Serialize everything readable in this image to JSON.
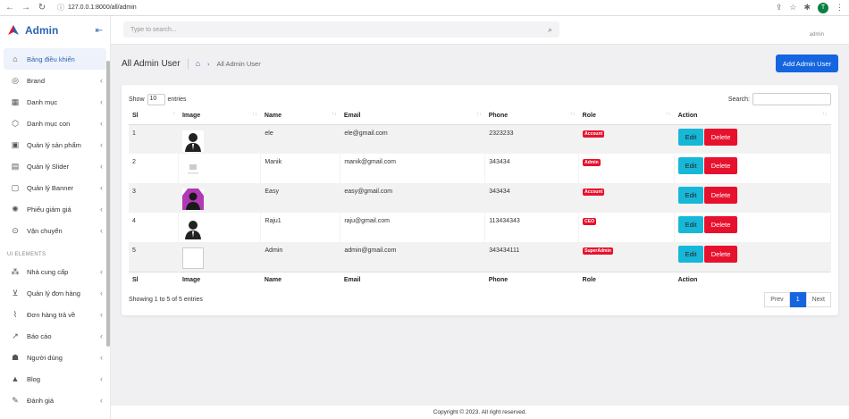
{
  "browser": {
    "url": "127.0.0.1:8000/all/admin",
    "profile_initial": "T"
  },
  "sidebar": {
    "brand": "Admin",
    "items": [
      {
        "label": "Bảng điều khiển",
        "icon": "home-icon",
        "glyph": "⌂",
        "active": true,
        "chevron": false
      },
      {
        "label": "Brand",
        "icon": "palette-icon",
        "glyph": "◎",
        "chevron": true
      },
      {
        "label": "Danh mục",
        "icon": "grid-icon",
        "glyph": "▦",
        "chevron": true
      },
      {
        "label": "Danh mục con",
        "icon": "box-icon",
        "glyph": "⬡",
        "chevron": true
      },
      {
        "label": "Quản lý sản phẩm",
        "icon": "products-icon",
        "glyph": "▣",
        "chevron": true
      },
      {
        "label": "Quản lý Slider",
        "icon": "slider-icon",
        "glyph": "▤",
        "chevron": true
      },
      {
        "label": "Quản lý Banner",
        "icon": "banner-icon",
        "glyph": "▢",
        "chevron": true
      },
      {
        "label": "Phiếu giảm giá",
        "icon": "coupon-icon",
        "glyph": "✺",
        "chevron": true
      },
      {
        "label": "Vận chuyển",
        "icon": "shipping-icon",
        "glyph": "⊙",
        "chevron": true
      }
    ],
    "section_label": "UI ELEMENTS",
    "items2": [
      {
        "label": "Nhà cung cấp",
        "icon": "supplier-icon",
        "glyph": "⁂",
        "chevron": true
      },
      {
        "label": "Quản lý đơn hàng",
        "icon": "cart-icon",
        "glyph": "⊻",
        "chevron": true
      },
      {
        "label": "Đơn hàng trả về",
        "icon": "attachment-icon",
        "glyph": "⌇",
        "chevron": true
      },
      {
        "label": "Báo cáo",
        "icon": "chart-icon",
        "glyph": "↗",
        "chevron": true
      },
      {
        "label": "Người dùng",
        "icon": "users-icon",
        "glyph": "☗",
        "chevron": true
      },
      {
        "label": "Blog",
        "icon": "blog-icon",
        "glyph": "▲",
        "chevron": true
      },
      {
        "label": "Đánh giá",
        "icon": "review-icon",
        "glyph": "✎",
        "chevron": true
      }
    ]
  },
  "topbar": {
    "search_placeholder": "Type to search...",
    "user_role": "admin"
  },
  "page": {
    "title": "All Admin User",
    "breadcrumb": "All Admin User",
    "add_button": "Add Admin User"
  },
  "table": {
    "show_label": "Show",
    "length_value": "10",
    "entries_label": "entries",
    "search_label": "Search:",
    "columns": [
      "Sl",
      "Image",
      "Name",
      "Email",
      "Phone",
      "Role",
      "Action"
    ],
    "rows": [
      {
        "sl": "1",
        "image": "person",
        "name": "ele",
        "email": "ele@gmail.com",
        "phone": "2323233",
        "role": "Account"
      },
      {
        "sl": "2",
        "image": "noimage",
        "name": "Manik",
        "email": "manik@gmail.com",
        "phone": "343434",
        "role": "Admin"
      },
      {
        "sl": "3",
        "image": "purple",
        "name": "Easy",
        "email": "easy@gmail.com",
        "phone": "343434",
        "role": "Account"
      },
      {
        "sl": "4",
        "image": "person",
        "name": "Raju1",
        "email": "raju@gmail.com",
        "phone": "113434343",
        "role": "CEO"
      },
      {
        "sl": "5",
        "image": "broken",
        "name": "Admin",
        "email": "admin@gmail.com",
        "phone": "343434111",
        "role": "SuperAdmin"
      }
    ],
    "edit_label": "Edit",
    "delete_label": "Delete",
    "info": "Showing 1 to 5 of 5 entries",
    "prev": "Prev",
    "page": "1",
    "next": "Next"
  },
  "footer": {
    "text": "Copyright © 2023. All right reserved."
  },
  "colors": {
    "primary": "#1565e0",
    "info": "#17b7d8",
    "danger": "#e8112d",
    "brand": "#2c64b4"
  }
}
